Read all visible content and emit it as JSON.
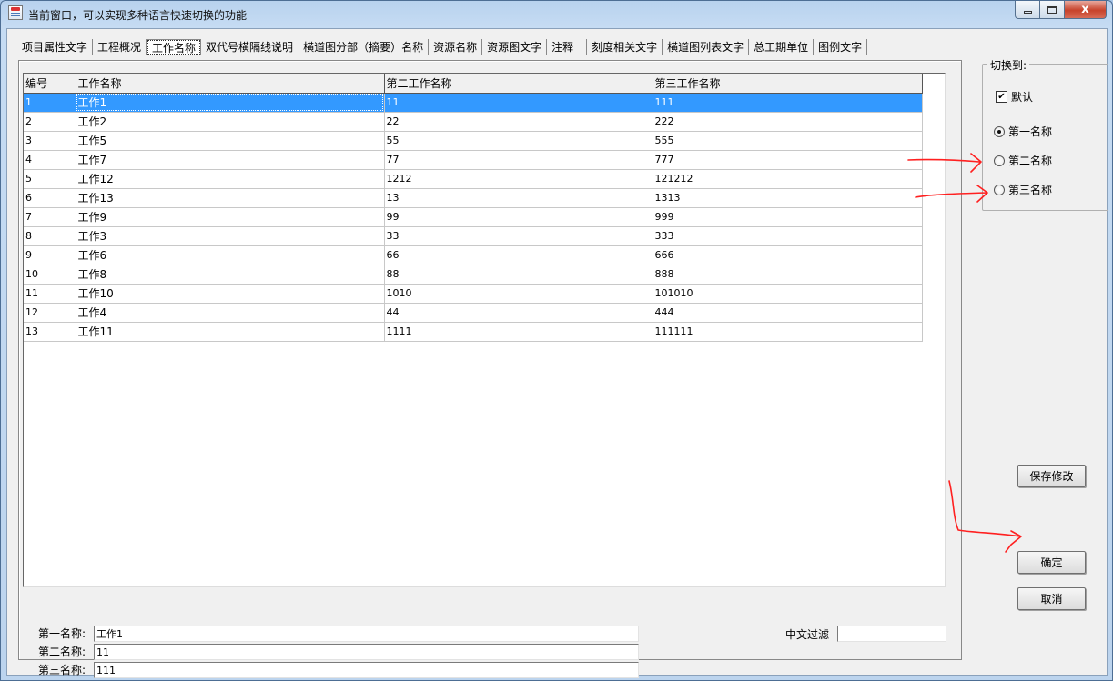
{
  "window": {
    "title": "当前窗口，可以实现多种语言快速切换的功能",
    "minimize": "minimize",
    "maximize": "maximize",
    "close": "x"
  },
  "tabs": [
    {
      "label": "项目属性文字"
    },
    {
      "label": "工程概况"
    },
    {
      "label": "工作名称",
      "active": true
    },
    {
      "label": "双代号横隔线说明"
    },
    {
      "label": "横道图分部（摘要）名称"
    },
    {
      "label": "资源名称"
    },
    {
      "label": "资源图文字"
    },
    {
      "label": "注释"
    },
    {
      "label": "刻度相关文字"
    },
    {
      "label": "横道图列表文字"
    },
    {
      "label": "总工期单位"
    },
    {
      "label": "图例文字"
    }
  ],
  "grid": {
    "columns": [
      "编号",
      "工作名称",
      "第二工作名称",
      "第三工作名称"
    ],
    "selected_row": 0,
    "rows": [
      [
        "1",
        "工作1",
        "11",
        "111"
      ],
      [
        "2",
        "工作2",
        "22",
        "222"
      ],
      [
        "3",
        "工作5",
        "55",
        "555"
      ],
      [
        "4",
        "工作7",
        "77",
        "777"
      ],
      [
        "5",
        "工作12",
        "1212",
        "121212"
      ],
      [
        "6",
        "工作13",
        "13",
        "1313"
      ],
      [
        "7",
        "工作9",
        "99",
        "999"
      ],
      [
        "8",
        "工作3",
        "33",
        "333"
      ],
      [
        "9",
        "工作6",
        "66",
        "666"
      ],
      [
        "10",
        "工作8",
        "88",
        "888"
      ],
      [
        "11",
        "工作10",
        "1010",
        "101010"
      ],
      [
        "12",
        "工作4",
        "44",
        "444"
      ],
      [
        "13",
        "工作11",
        "1111",
        "111111"
      ]
    ]
  },
  "fields": {
    "first_label": "第一名称:",
    "first_value": "工作1",
    "second_label": "第二名称:",
    "second_value": "11",
    "third_label": "第三名称:",
    "third_value": "111",
    "filter_label": "中文过滤",
    "filter_value": ""
  },
  "switch_group": {
    "legend": "切换到:",
    "default_label": "默认",
    "default_checked": true,
    "option1": "第一名称",
    "option2": "第二名称",
    "option3": "第三名称",
    "selected_option": 1
  },
  "buttons": {
    "save": "保存修改",
    "ok": "确定",
    "cancel": "取消"
  },
  "colors": {
    "selection": "#3399ff",
    "annotation": "#ff2020"
  }
}
